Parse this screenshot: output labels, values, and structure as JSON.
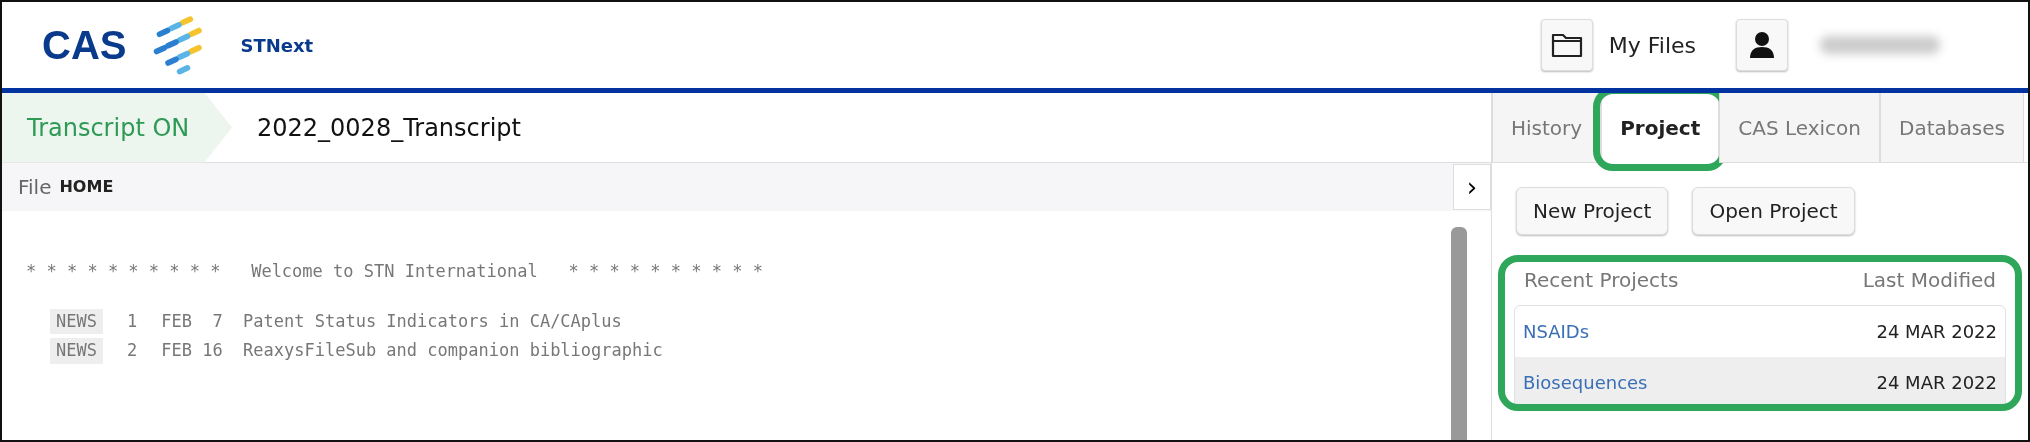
{
  "header": {
    "logo_text": "CAS",
    "product": "STNext",
    "my_files": "My Files"
  },
  "transcript": {
    "status": "Transcript ON",
    "on": true,
    "name": "2022_0028_Transcript"
  },
  "toolbar": {
    "menu": "File",
    "location": "HOME",
    "collapse_glyph": "›"
  },
  "console_lines": [
    {
      "kind": "banner",
      "text": "* * * * * * * * * *   Welcome to STN International   * * * * * * * * * *"
    },
    {
      "kind": "news",
      "tag": "NEWS",
      "num": "1",
      "text": "FEB  7  Patent Status Indicators in CA/CAplus"
    },
    {
      "kind": "news",
      "tag": "NEWS",
      "num": "2",
      "text": "FEB 16  ReaxysFileSub and companion bibliographic"
    }
  ],
  "tabs": [
    {
      "label": "History",
      "selected": false,
      "highlighted": false
    },
    {
      "label": "Project",
      "selected": true,
      "highlighted": true
    },
    {
      "label": "CAS Lexicon",
      "selected": false,
      "highlighted": false
    },
    {
      "label": "Databases",
      "selected": false,
      "highlighted": false
    }
  ],
  "buttons": [
    "New Project",
    "Open Project"
  ],
  "recent_projects": {
    "highlighted": true,
    "columns": [
      "Recent Projects",
      "Last Modified"
    ],
    "rows": [
      {
        "name": "NSAIDs",
        "modified": "24 MAR 2022",
        "selected": false
      },
      {
        "name": "Biosequences",
        "modified": "24 MAR 2022",
        "selected": true
      }
    ]
  }
}
